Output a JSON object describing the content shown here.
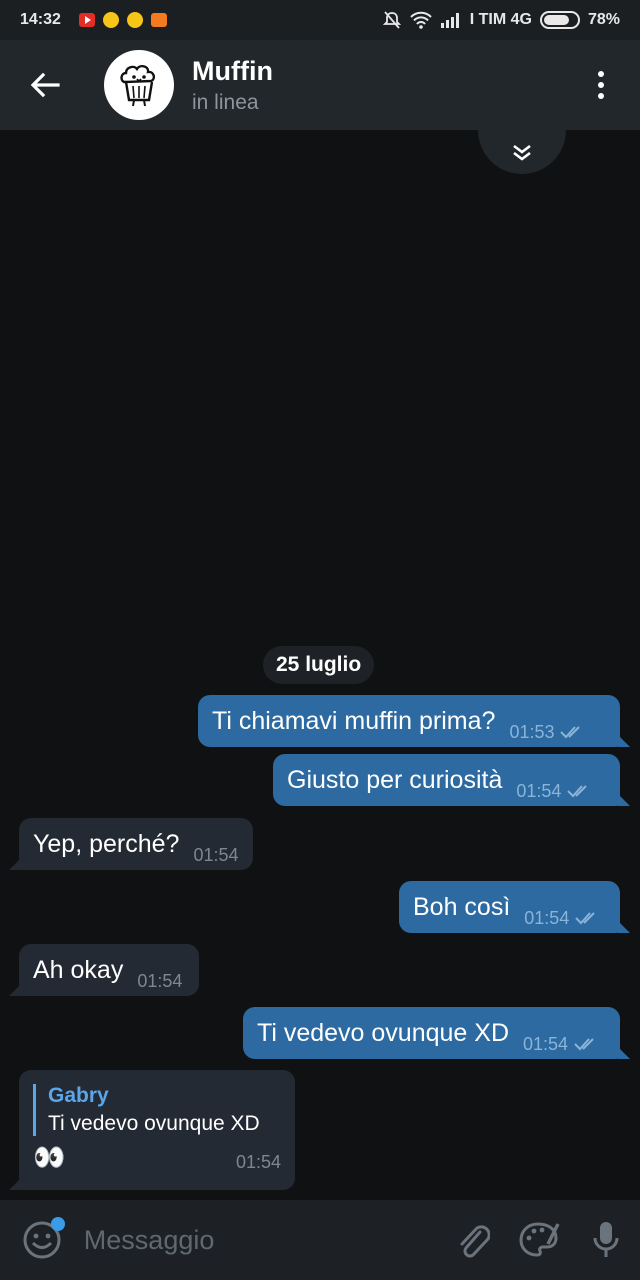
{
  "status_bar": {
    "time": "14:32",
    "carrier": "I TIM 4G",
    "battery": "78%",
    "battery_level": 0.78
  },
  "header": {
    "title": "Muffin",
    "subtitle": "in linea"
  },
  "chat": {
    "date_label": "25 luglio",
    "messages": [
      {
        "text": "Ti chiamavi muffin prima?",
        "time": "01:53"
      },
      {
        "text": "Giusto per curiosità",
        "time": "01:54"
      },
      {
        "text": "Yep, perché?",
        "time": "01:54"
      },
      {
        "text": "Boh così",
        "time": "01:54"
      },
      {
        "text": "Ah okay",
        "time": "01:54"
      },
      {
        "text": "Ti vedevo ovunque XD",
        "time": "01:54"
      },
      {
        "quote_name": "Gabry",
        "quote_text": "Ti vedevo ovunque XD",
        "text": "👀",
        "time": "01:54"
      }
    ]
  },
  "input": {
    "placeholder": "Messaggio"
  },
  "colors": {
    "background": "#0f1113",
    "header": "#22272c",
    "outgoing_bubble": "#2c6aa1",
    "incoming_bubble": "#232a33",
    "accent": "#5aa6e8"
  }
}
